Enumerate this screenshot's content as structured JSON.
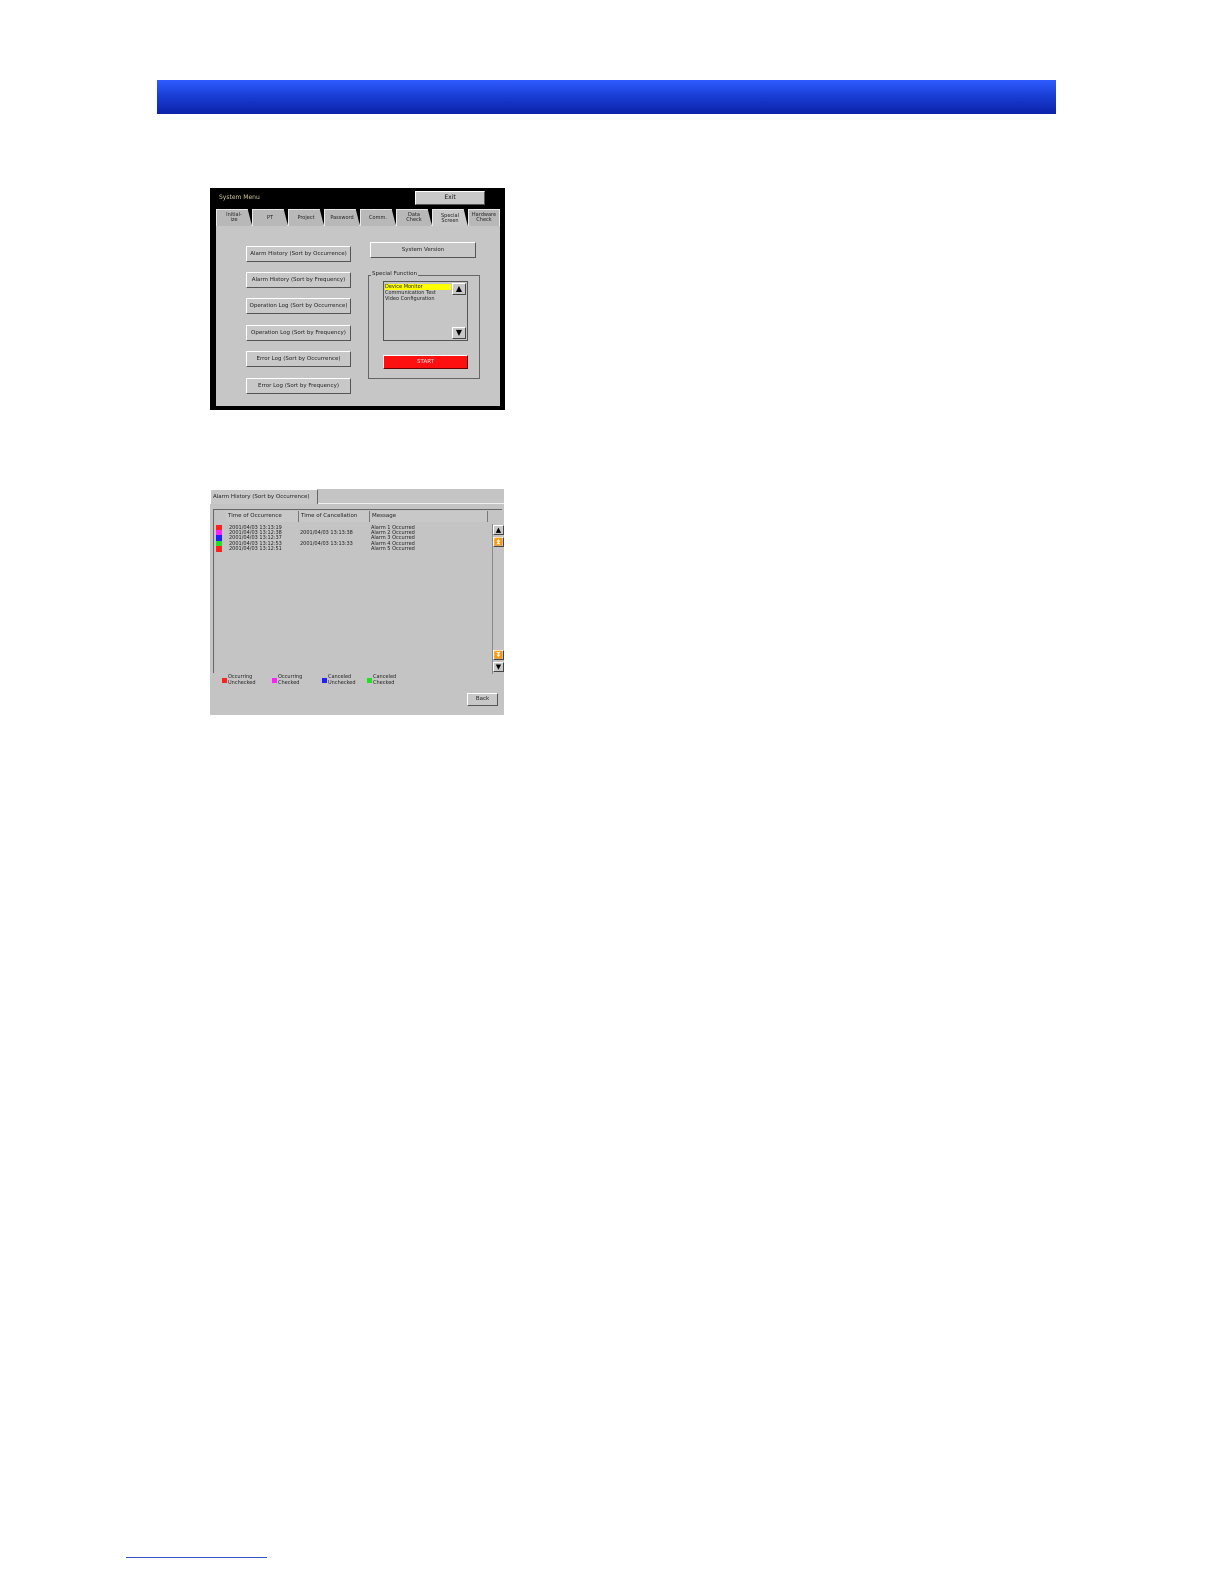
{
  "system_menu": {
    "title": "System Menu",
    "exit_label": "Exit",
    "tabs": [
      {
        "label": "Initial-\nize"
      },
      {
        "label": "PT"
      },
      {
        "label": "Project"
      },
      {
        "label": "Password"
      },
      {
        "label": "Comm."
      },
      {
        "label": "Data\nCheck"
      },
      {
        "label": "Special\nScreen"
      },
      {
        "label": "Hardware\nCheck"
      }
    ],
    "active_tab": "Special\nScreen",
    "buttons": [
      {
        "label": "Alarm History (Sort by Occurrence)"
      },
      {
        "label": "Alarm History (Sort by Frequency)"
      },
      {
        "label": "Operation Log (Sort by Occurrence)"
      },
      {
        "label": "Operation Log (Sort by Frequency)"
      },
      {
        "label": "Error Log (Sort by Occurrence)"
      },
      {
        "label": "Error Log (Sort by Frequency)"
      }
    ],
    "system_version_label": "System Version",
    "special_function": {
      "legend": "Special Function",
      "items": [
        "Device Monitor",
        "Communication Test",
        "Video Configuration"
      ],
      "selected": "Device Monitor",
      "start_label": "START",
      "up_arrow": "▲",
      "down_arrow": "▼"
    }
  },
  "alarm_history": {
    "tab_label": "Alarm History (Sort by Occurrence)",
    "columns": [
      "Time of Occurrence",
      "Time of Cancellation",
      "Message"
    ],
    "rows": [
      {
        "occurrence": "2001/04/03  13:13:19",
        "cancellation": "",
        "message": "Alarm 1 Occurred",
        "color": "#ff2020"
      },
      {
        "occurrence": "2001/04/03  13:12:38",
        "cancellation": "2001/04/03  13:13:38",
        "message": "Alarm 2 Occurred",
        "color": "#ff20ff"
      },
      {
        "occurrence": "2001/04/03  13:12:37",
        "cancellation": "",
        "message": "Alarm 3 Occurred",
        "color": "#2020ff"
      },
      {
        "occurrence": "2001/04/03  13:12:53",
        "cancellation": "2001/04/03  13:13:33",
        "message": "Alarm 4 Occurred",
        "color": "#20e020"
      },
      {
        "occurrence": "2001/04/03  13:12:51",
        "cancellation": "",
        "message": "Alarm 5 Occurred",
        "color": "#ff2020"
      }
    ],
    "scroll_icons": {
      "page_up": "▲",
      "top": "⏫",
      "bottom": "⏬",
      "page_down": "▼"
    },
    "legend": [
      {
        "line1": "Occurring",
        "line2": "Unchecked",
        "color": "#ff2020"
      },
      {
        "line1": "Occurring",
        "line2": "Checked",
        "color": "#ff20ff"
      },
      {
        "line1": "Canceled",
        "line2": "Unchecked",
        "color": "#2020ff"
      },
      {
        "line1": "Canceled",
        "line2": "Checked",
        "color": "#20e020"
      }
    ],
    "back_label": "Back"
  },
  "colors": {
    "header_bar": "#1a3fd6",
    "selected_item": "#ffff00",
    "start_button": "#ff1010"
  }
}
